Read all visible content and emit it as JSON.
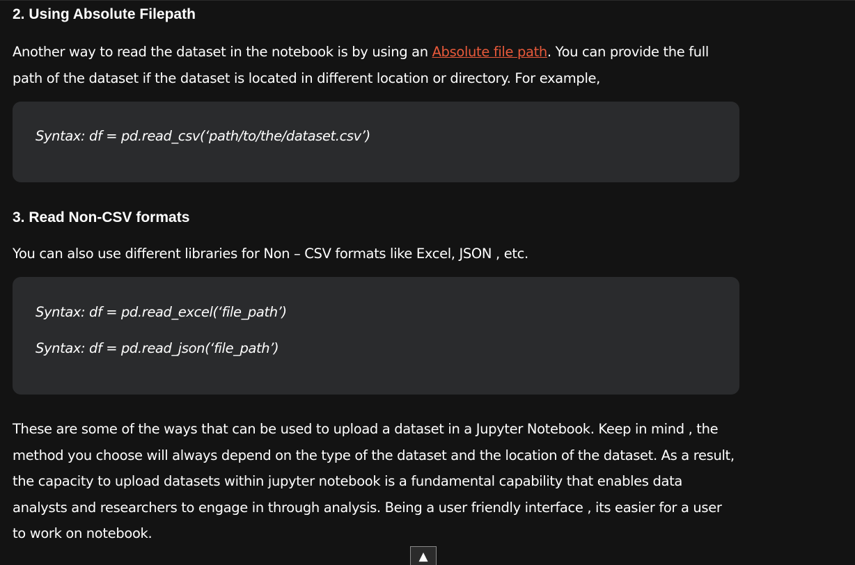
{
  "section2": {
    "heading": "2. Using Absolute Filepath",
    "para_before_link": "Another way to read the dataset in the notebook is by using an ",
    "link_text": "Absolute file path",
    "para_after_link": ". You can provide the full path of the dataset if the dataset is located in different location or directory. For example,",
    "code": [
      "Syntax: df = pd.read_csv(‘path/to/the/dataset.csv’)"
    ]
  },
  "section3": {
    "heading": "3. Read Non-CSV formats",
    "para": "You can also use different libraries for Non – CSV formats like Excel, JSON , etc.",
    "code": [
      "Syntax: df = pd.read_excel(‘file_path’)",
      "Syntax: df = pd.read_json(‘file_path’)"
    ]
  },
  "conclusion": {
    "para": "These are some of the ways that can be used to upload a dataset in a Jupyter Notebook. Keep in mind , the method you choose will always depend on the type of the dataset and the location of the dataset. As a result, the capacity to upload datasets within jupyter notebook is a fundamental capability that enables data analysts and researchers to engage in through analysis. Being a user friendly interface , its easier for a user to work on notebook."
  },
  "scroll_top": {
    "icon": "triangle-up-icon",
    "glyph": "▲"
  },
  "colors": {
    "background": "#131313",
    "code_background": "#2a2b2d",
    "link": "#e8593a",
    "text": "#ffffff"
  }
}
